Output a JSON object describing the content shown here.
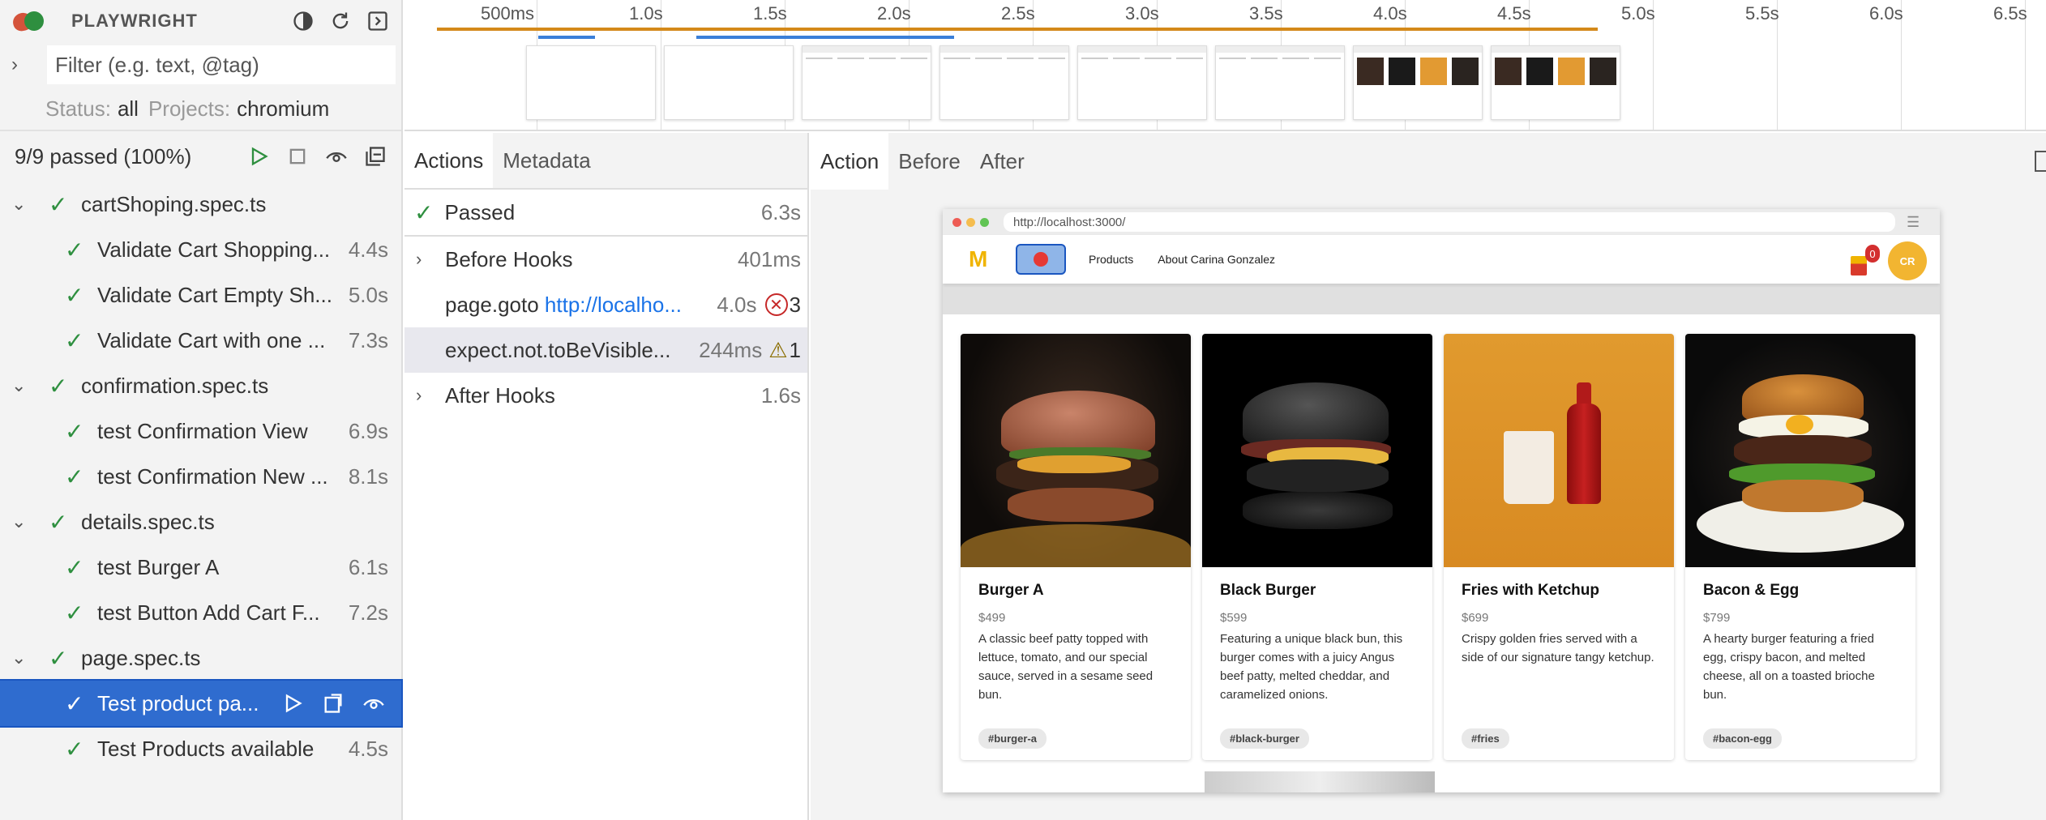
{
  "app": {
    "title": "PLAYWRIGHT",
    "filter_placeholder": "Filter (e.g. text, @tag)",
    "status_label": "Status:",
    "status_value": "all",
    "projects_label": "Projects:",
    "projects_value": "chromium",
    "summary": "9/9 passed (100%)"
  },
  "tree": [
    {
      "kind": "file",
      "name": "cartShoping.spec.ts"
    },
    {
      "kind": "test",
      "name": "Validate Cart Shopping...",
      "duration": "4.4s"
    },
    {
      "kind": "test",
      "name": "Validate Cart Empty Sh...",
      "duration": "5.0s"
    },
    {
      "kind": "test",
      "name": "Validate Cart with one ...",
      "duration": "7.3s"
    },
    {
      "kind": "file",
      "name": "confirmation.spec.ts"
    },
    {
      "kind": "test",
      "name": "test Confirmation View",
      "duration": "6.9s"
    },
    {
      "kind": "test",
      "name": "test Confirmation New ...",
      "duration": "8.1s"
    },
    {
      "kind": "file",
      "name": "details.spec.ts"
    },
    {
      "kind": "test",
      "name": "test Burger A",
      "duration": "6.1s"
    },
    {
      "kind": "test",
      "name": "test Button Add Cart F...",
      "duration": "7.2s"
    },
    {
      "kind": "file",
      "name": "page.spec.ts"
    },
    {
      "kind": "test",
      "name": "Test product pa...",
      "duration": "",
      "selected": true
    },
    {
      "kind": "test",
      "name": "Test Products available",
      "duration": "4.5s"
    }
  ],
  "timeline": {
    "ticks": [
      "500ms",
      "1.0s",
      "1.5s",
      "2.0s",
      "2.5s",
      "3.0s",
      "3.5s",
      "4.0s",
      "4.5s",
      "5.0s",
      "5.5s",
      "6.0s",
      "6.5s"
    ]
  },
  "actions_tabs": [
    "Actions",
    "Metadata"
  ],
  "actions": {
    "passed_label": "Passed",
    "passed_duration": "6.3s",
    "before_hooks": "Before Hooks",
    "before_hooks_duration": "401ms",
    "goto_name": "page.goto",
    "goto_url": "http://localho...",
    "goto_duration": "4.0s",
    "goto_errors": "3",
    "expect_name": "expect.not.toBeVisible...",
    "expect_duration": "244ms",
    "expect_warnings": "1",
    "after_hooks": "After Hooks",
    "after_hooks_duration": "1.6s"
  },
  "snapshot_tabs": [
    "Action",
    "Before",
    "After"
  ],
  "browser": {
    "url": "http://localhost:3000/",
    "logo": "M",
    "nav_products": "Products",
    "nav_about": "About Carina Gonzalez",
    "cart_count": "0",
    "avatar": "CR"
  },
  "products": [
    {
      "title": "Burger A",
      "price": "$499",
      "desc": "A classic beef patty topped with lettuce, tomato, and our special sauce, served in a sesame seed bun.",
      "tag": "#burger-a"
    },
    {
      "title": "Black Burger",
      "price": "$599",
      "desc": "Featuring a unique black bun, this burger comes with a juicy Angus beef patty, melted cheddar, and caramelized onions.",
      "tag": "#black-burger"
    },
    {
      "title": "Fries with Ketchup",
      "price": "$699",
      "desc": "Crispy golden fries served with a side of our signature tangy ketchup.",
      "tag": "#fries"
    },
    {
      "title": "Bacon & Egg",
      "price": "$799",
      "desc": "A hearty burger featuring a fried egg, crispy bacon, and melted cheese, all on a toasted brioche bun.",
      "tag": "#bacon-egg"
    }
  ],
  "colors": {
    "accent": "#2f6ccf",
    "pass": "#2e8f3f",
    "error": "#c62828",
    "timeline_orange": "#d4891a",
    "timeline_blue": "#3b7fd8"
  }
}
